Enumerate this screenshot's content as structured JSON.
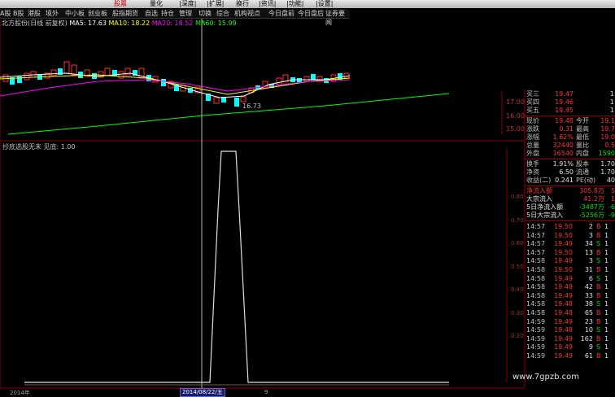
{
  "menu": {
    "items": [
      {
        "label": "股票",
        "active": true
      },
      {
        "label": "量化",
        "active": false
      },
      {
        "label": "|深度|",
        "active": false
      },
      {
        "label": "|扩展|",
        "active": false
      },
      {
        "label": "换行",
        "active": false
      },
      {
        "label": "|资讯|",
        "active": false
      },
      {
        "label": "|功能|",
        "active": false
      },
      {
        "label": "|设置|",
        "active": false
      }
    ]
  },
  "tabs": [
    {
      "label": "A股",
      "active": false
    },
    {
      "label": "B股",
      "active": false
    },
    {
      "label": "港股",
      "active": false
    },
    {
      "label": "境外",
      "active": false
    },
    {
      "label": "中小板",
      "active": false
    },
    {
      "label": "创业板",
      "active": false
    },
    {
      "label": "股指期货",
      "active": false
    },
    {
      "label": "自选",
      "active": false
    },
    {
      "label": "持仓",
      "active": false
    },
    {
      "label": "管理",
      "active": false
    },
    {
      "label": "切换",
      "active": false
    },
    {
      "label": "综合",
      "active": false
    },
    {
      "label": "机构视点",
      "active": false
    },
    {
      "label": "今日盘前",
      "active": false
    },
    {
      "label": "今日盘后",
      "active": false
    },
    {
      "label": "证券要闻",
      "active": false
    }
  ],
  "chart_header": {
    "title": "北方股份(日线 前复权)",
    "ma5": "MA5: 17.63",
    "ma10": "MA10: 18.22",
    "ma20": "MA20: 18.52",
    "ma60": "MA60: 15.99"
  },
  "low_label": "16.73",
  "indicator_title": "抄底选股无未  见底: 1.00",
  "dates": {
    "left": "2014年",
    "cursor": "2014/08/22/五",
    "right": "9"
  },
  "price_ticks": [
    "17.00",
    "16.00",
    "15.00"
  ],
  "indicator_ticks": [
    "0.80",
    "0.70",
    "0.60",
    "0.50",
    "0.40",
    "0.30",
    "0.20"
  ],
  "colors": {
    "up": "#ff3030",
    "down": "#00ffff",
    "ma5": "#ffffff",
    "ma10": "#ffff00",
    "ma20": "#ff00ff",
    "ma60": "#00ff00",
    "grid": "#8b0000"
  },
  "quote": {
    "asks": [
      {
        "label": "买三",
        "value": "19.47",
        "extra": "1"
      },
      {
        "label": "买四",
        "value": "19.46",
        "extra": "1"
      },
      {
        "label": "买五",
        "value": "19.45",
        "extra": "1"
      }
    ],
    "stats": [
      {
        "l1": "现价",
        "v1": "19.48",
        "l2": "今开",
        "v2": "19.1"
      },
      {
        "l1": "涨跌",
        "v1": "0.31",
        "l2": "最高",
        "v2": "19.7"
      },
      {
        "l1": "涨幅",
        "v1": "1.62%",
        "l2": "最低",
        "v2": "19.0"
      },
      {
        "l1": "总量",
        "v1": "32440",
        "l2": "量比",
        "v2": "0.5"
      },
      {
        "l1": "外盘",
        "v1": "16540",
        "l2": "内盘",
        "v2": "1590"
      }
    ],
    "stats2": [
      {
        "l1": "换手",
        "v1": "1.91%",
        "l2": "股本",
        "v2": "1.70"
      },
      {
        "l1": "净资",
        "v1": "6.50",
        "l2": "流通",
        "v2": "1.70"
      },
      {
        "l1": "收益(二)",
        "v1": "0.241",
        "l2": "PE(动)",
        "v2": "40"
      }
    ],
    "flows": [
      {
        "label": "净流入额",
        "value": "305.8万",
        "extra": "5"
      },
      {
        "label": "大宗流入",
        "value": "41.2万",
        "extra": "1"
      },
      {
        "label": "5日净流入额",
        "value": "-3487万",
        "extra": "-6"
      },
      {
        "label": "5日大宗流入",
        "value": "-5256万",
        "extra": "-9"
      }
    ]
  },
  "ticks": [
    {
      "time": "14:57",
      "price": "19.50",
      "vol": "2",
      "side": "B",
      "extra": "1"
    },
    {
      "time": "14:57",
      "price": "19.50",
      "vol": "3",
      "side": "B",
      "extra": "1"
    },
    {
      "time": "14:57",
      "price": "19.49",
      "vol": "34",
      "side": "S",
      "extra": "1"
    },
    {
      "time": "14:57",
      "price": "19.50",
      "vol": "13",
      "side": "B",
      "extra": "1"
    },
    {
      "time": "14:58",
      "price": "19.49",
      "vol": "3",
      "side": "S",
      "extra": "1"
    },
    {
      "time": "14:58",
      "price": "19.50",
      "vol": "31",
      "side": "B",
      "extra": "1"
    },
    {
      "time": "14:58",
      "price": "19.49",
      "vol": "6",
      "side": "S",
      "extra": "1"
    },
    {
      "time": "14:58",
      "price": "19.49",
      "vol": "42",
      "side": "B",
      "extra": "1"
    },
    {
      "time": "14:58",
      "price": "19.49",
      "vol": "33",
      "side": "B",
      "extra": "1"
    },
    {
      "time": "14:58",
      "price": "19.48",
      "vol": "38",
      "side": "S",
      "extra": "1"
    },
    {
      "time": "14:58",
      "price": "19.48",
      "vol": "65",
      "side": "B",
      "extra": "1"
    },
    {
      "time": "14:59",
      "price": "19.49",
      "vol": "23",
      "side": "B",
      "extra": "1"
    },
    {
      "time": "14:59",
      "price": "19.48",
      "vol": "10",
      "side": "S",
      "extra": "1"
    },
    {
      "time": "14:59",
      "price": "19.49",
      "vol": "162",
      "side": "B",
      "extra": "1"
    },
    {
      "time": "14:59",
      "price": "19.49",
      "vol": "9",
      "side": "S",
      "extra": "1"
    },
    {
      "time": "14:59",
      "price": "19.49",
      "vol": "61",
      "side": "B",
      "extra": "1"
    }
  ],
  "watermark": "www.7gpzb.com"
}
